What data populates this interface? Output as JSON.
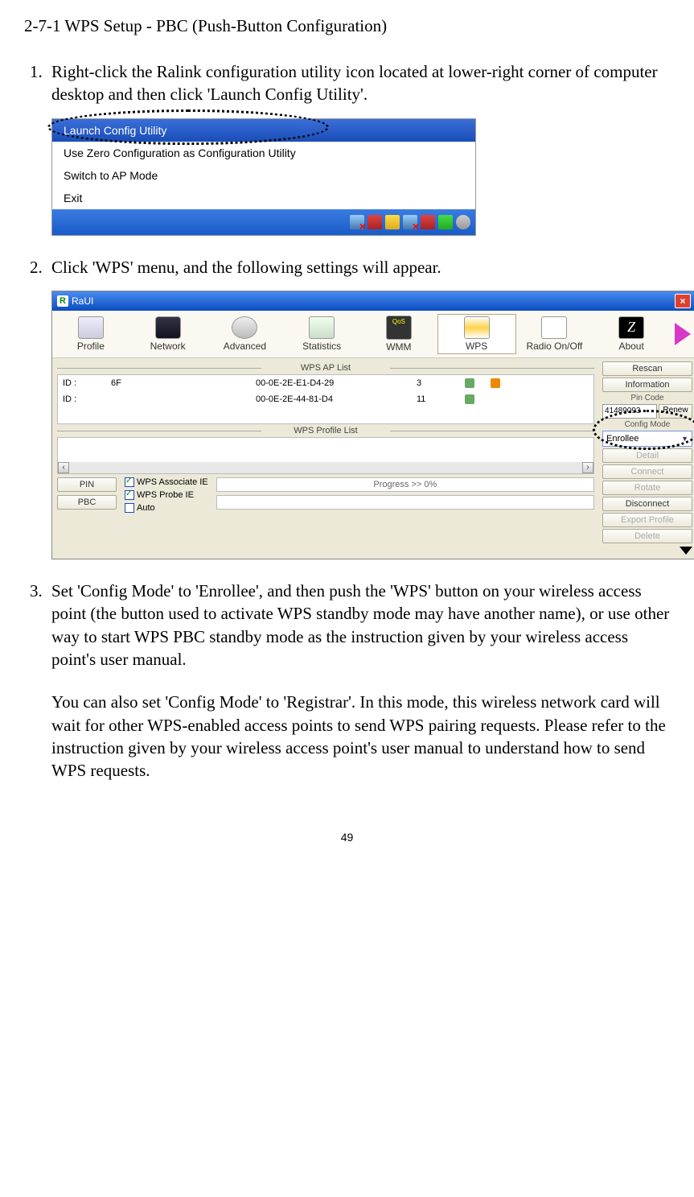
{
  "section_title": "2-7-1 WPS Setup - PBC (Push-Button Configuration)",
  "steps": {
    "s1": "Right-click the Ralink configuration utility icon located at lower-right corner of computer desktop and then click 'Launch Config Utility'.",
    "s2": "Click 'WPS' menu, and the following settings will appear.",
    "s3a": "Set 'Config Mode' to 'Enrollee', and then push the 'WPS' button on your wireless access point (the button used to activate WPS standby mode may have another name), or use other way to start WPS PBC standby mode as the instruction given by your wireless access point's user manual.",
    "s3b": "You can also set 'Config Mode' to 'Registrar'. In this mode, this wireless network card will wait for other WPS-enabled access points to send WPS pairing requests. Please refer to the instruction given by your wireless access point's user manual to understand how to send WPS requests."
  },
  "context_menu": {
    "items": [
      "Launch Config Utility",
      "Use Zero Configuration as Configuration Utility",
      "Switch to AP Mode",
      "Exit"
    ]
  },
  "raui": {
    "title": "RaUI",
    "toolbar": [
      "Profile",
      "Network",
      "Advanced",
      "Statistics",
      "WMM",
      "WPS",
      "Radio On/Off",
      "About"
    ],
    "ap_list_label": "WPS AP List",
    "profile_list_label": "WPS Profile List",
    "ap_rows": [
      {
        "id": "ID :",
        "name": "6F",
        "mac": "00-0E-2E-E1-D4-29",
        "ch": "3"
      },
      {
        "id": "ID :",
        "name": "",
        "mac": "00-0E-2E-44-81-D4",
        "ch": "11"
      }
    ],
    "buttons_left": {
      "pin": "PIN",
      "pbc": "PBC"
    },
    "checks": {
      "assoc": "WPS Associate IE",
      "probe": "WPS Probe IE",
      "auto": "Auto"
    },
    "progress": "Progress >> 0%",
    "side": {
      "rescan": "Rescan",
      "info": "Information",
      "pin_label": "Pin Code",
      "pin_value": "41489093",
      "renew": "Renew",
      "cfg_label": "Config Mode",
      "cfg_value": "Enrollee",
      "detail": "Detail",
      "connect": "Connect",
      "rotate": "Rotate",
      "disconnect": "Disconnect",
      "export": "Export Profile",
      "delete": "Delete"
    }
  },
  "page_number": "49"
}
